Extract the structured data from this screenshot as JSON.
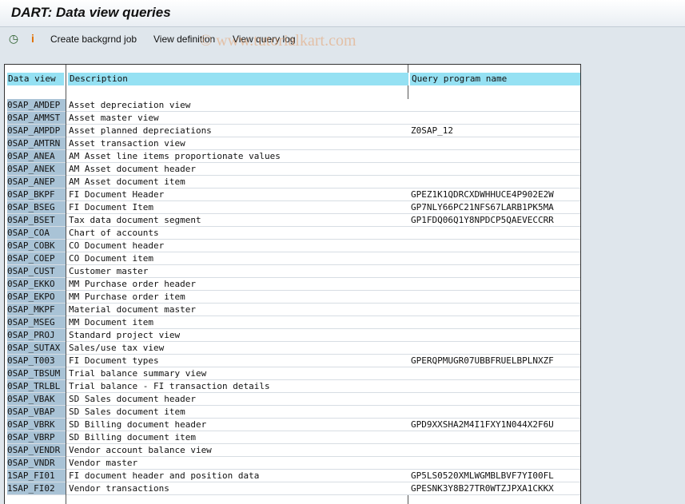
{
  "window": {
    "title": "DART: Data view queries"
  },
  "toolbar": {
    "create_label": "Create backgrnd job",
    "view_def_label": "View definition",
    "view_log_label": "View query log"
  },
  "watermark": "© www.tutorialkart.com",
  "table": {
    "headers": [
      "Data view",
      "Description",
      "Query program name"
    ],
    "rows": [
      [
        "0SAP_AMDEP",
        "Asset depreciation view",
        ""
      ],
      [
        "0SAP_AMMST",
        "Asset master view",
        ""
      ],
      [
        "0SAP_AMPDP",
        "Asset planned depreciations",
        "Z0SAP_12"
      ],
      [
        "0SAP_AMTRN",
        "Asset transaction view",
        ""
      ],
      [
        "0SAP_ANEA",
        "AM Asset line items proportionate values",
        ""
      ],
      [
        "0SAP_ANEK",
        "AM Asset document header",
        ""
      ],
      [
        "0SAP_ANEP",
        "AM Asset document item",
        ""
      ],
      [
        "0SAP_BKPF",
        "FI Document Header",
        "GPEZ1K1QDRCXDWHHUCE4P902E2W"
      ],
      [
        "0SAP_BSEG",
        "FI Document Item",
        "GP7NLY66PC21NFS67LARB1PK5MA"
      ],
      [
        "0SAP_BSET",
        "Tax data document segment",
        "GP1FDQ06Q1Y8NPDCP5QAEVECCRR"
      ],
      [
        "0SAP_COA",
        "Chart of accounts",
        ""
      ],
      [
        "0SAP_COBK",
        "CO Document header",
        ""
      ],
      [
        "0SAP_COEP",
        "CO Document item",
        ""
      ],
      [
        "0SAP_CUST",
        "Customer master",
        ""
      ],
      [
        "0SAP_EKKO",
        "MM Purchase order header",
        ""
      ],
      [
        "0SAP_EKPO",
        "MM Purchase order item",
        ""
      ],
      [
        "0SAP_MKPF",
        "Material document master",
        ""
      ],
      [
        "0SAP_MSEG",
        "MM Document item",
        ""
      ],
      [
        "0SAP_PROJ",
        "Standard project view",
        ""
      ],
      [
        "0SAP_SUTAX",
        "Sales/use tax view",
        ""
      ],
      [
        "0SAP_T003",
        "FI Document types",
        "GPERQPMUGR07UBBFRUELBPLNXZF"
      ],
      [
        "0SAP_TBSUM",
        "Trial balance summary view",
        ""
      ],
      [
        "0SAP_TRLBL",
        "Trial balance - FI transaction details",
        ""
      ],
      [
        "0SAP_VBAK",
        "SD Sales document header",
        ""
      ],
      [
        "0SAP_VBAP",
        "SD Sales document item",
        ""
      ],
      [
        "0SAP_VBRK",
        "SD Billing document header",
        "GPD9XXSHA2M4I1FXY1N044X2F6U"
      ],
      [
        "0SAP_VBRP",
        "SD Billing document item",
        ""
      ],
      [
        "0SAP_VENDR",
        "Vendor account balance view",
        ""
      ],
      [
        "0SAP_VNDR",
        "Vendor master",
        ""
      ],
      [
        "1SAP_FI01",
        "FI document header and position data",
        "GP5LS0520XMLWGMBLBVF7YI00FL"
      ],
      [
        "1SAP_FI02",
        "Vendor transactions",
        "GPESNK3Y8B27TR0WTZJPXA1CKKX"
      ]
    ]
  }
}
